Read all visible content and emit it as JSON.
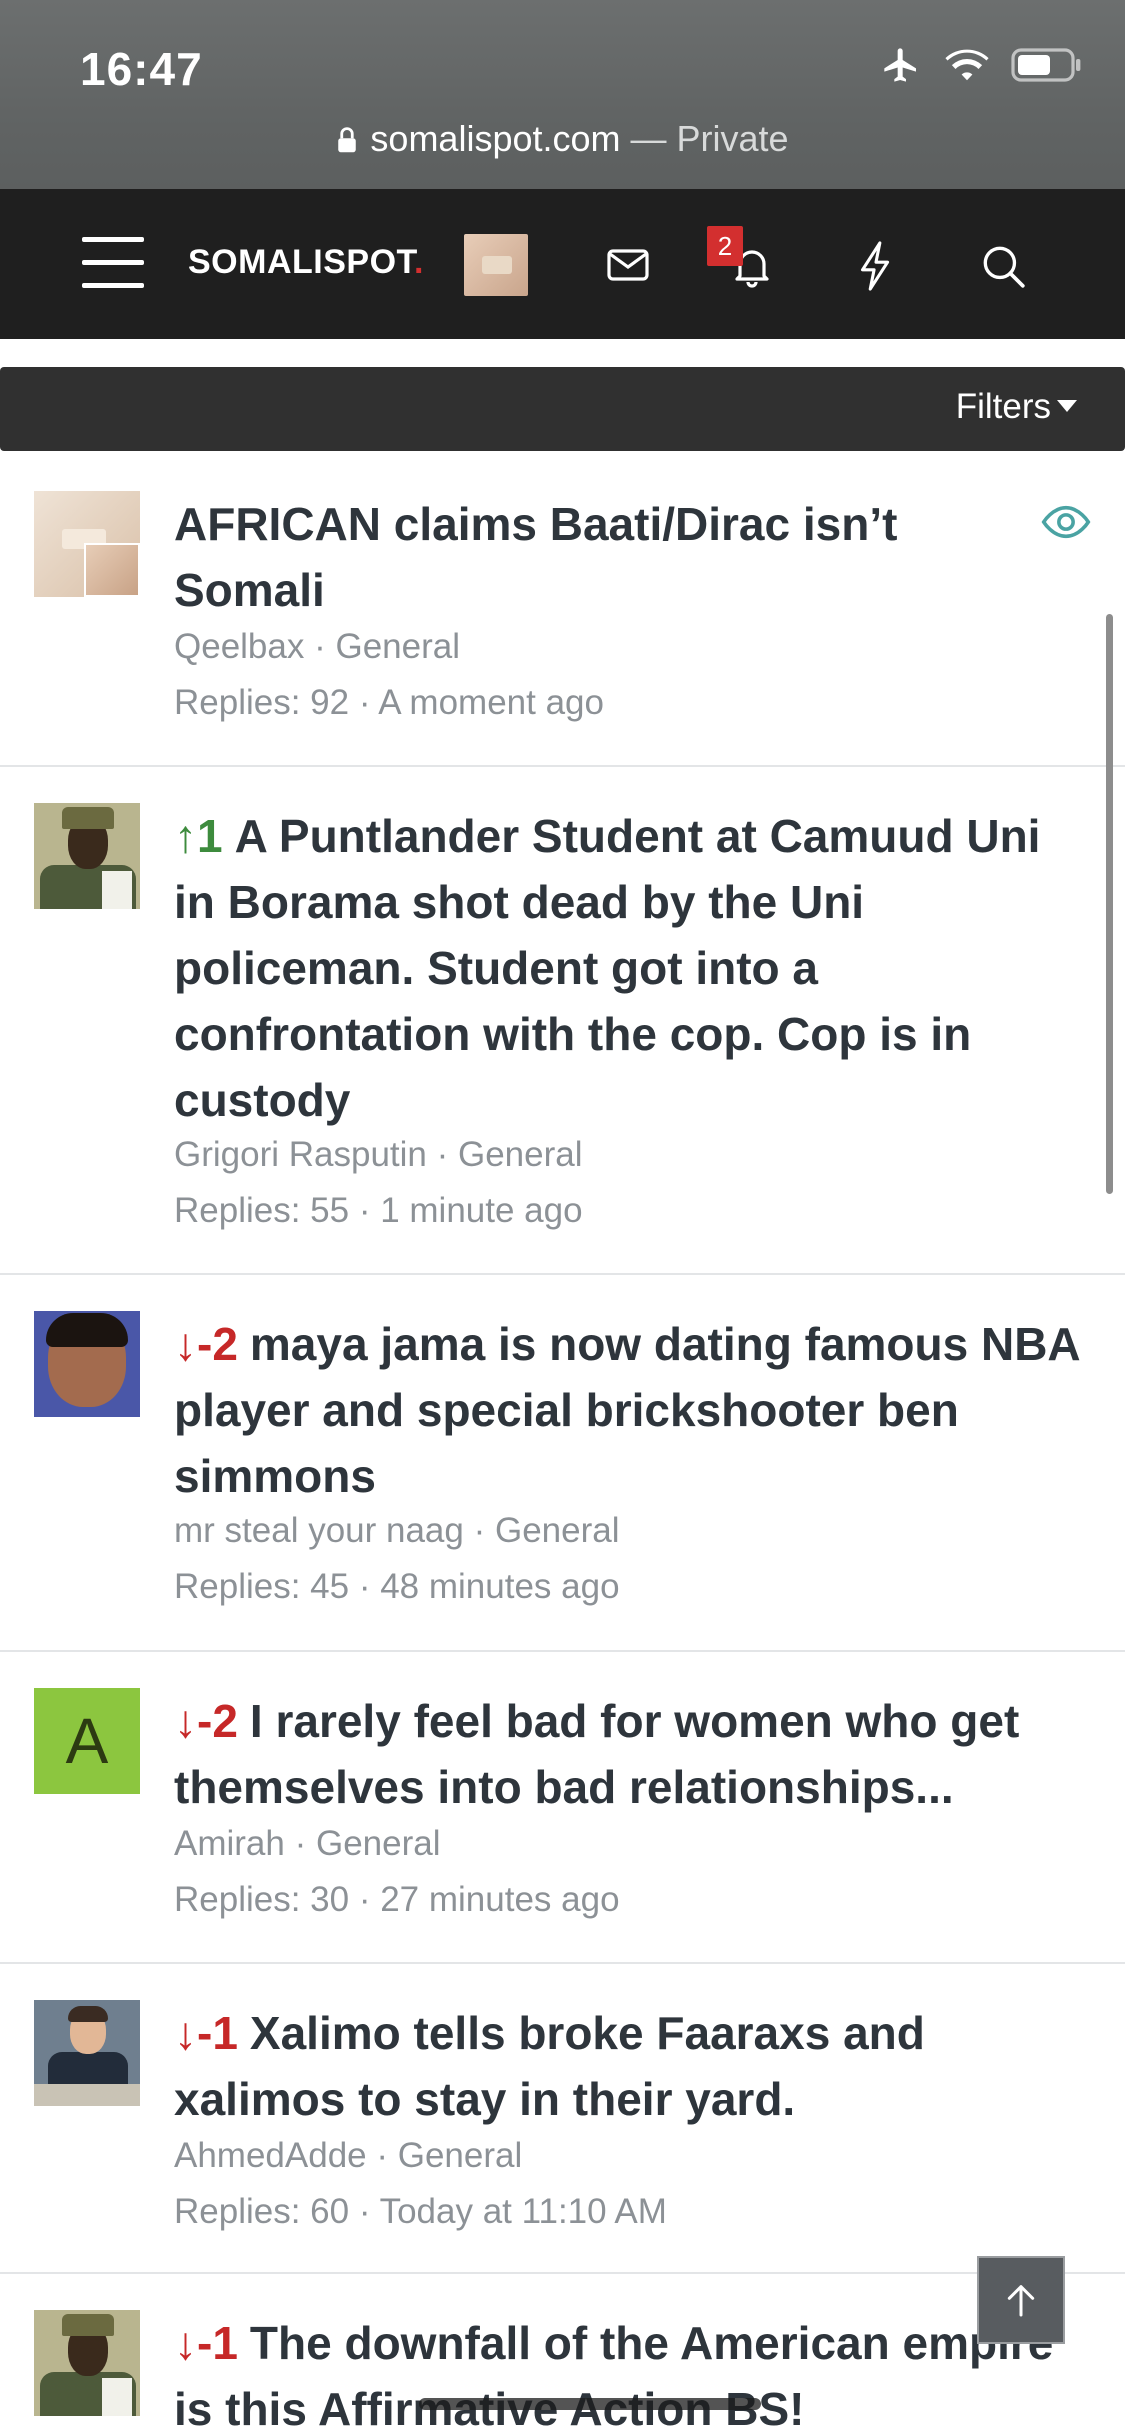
{
  "status_bar": {
    "time": "16:47"
  },
  "browser": {
    "domain": "somalispot.com",
    "suffix": " — Private"
  },
  "header": {
    "logo_text": "SOMALISPOT",
    "logo_dot": ".",
    "alerts_count": "2",
    "icons": [
      "menu-icon",
      "avatar",
      "mail-icon",
      "bell-icon",
      "lightning-icon",
      "search-icon"
    ]
  },
  "filter_bar": {
    "label": "Filters"
  },
  "threads": [
    {
      "vote": "",
      "title": "AFRICAN claims Baati/Dirac isn’t Somali",
      "meta": "Qeelbax · General",
      "stats": "Replies: 92 · A moment ago"
    },
    {
      "vote": "↑1",
      "title": "A Puntlander Student at Camuud Uni in Borama shot dead by the Uni policeman. Student got into a confrontation with the cop. Cop is in custody",
      "meta": "Grigori Rasputin · General",
      "stats": "Replies: 55 · 1 minute ago"
    },
    {
      "vote": "↓-2",
      "title": "maya jama is now dating famous NBA player and special brickshooter ben simmons",
      "meta": "mr steal your naag · General",
      "stats": "Replies: 45 · 48 minutes ago"
    },
    {
      "vote": "↓-2",
      "title": "I rarely feel bad for women who get themselves into bad relationships...",
      "meta": "Amirah · General",
      "stats": "Replies: 30 · 27 minutes ago",
      "avatar_letter": "A"
    },
    {
      "vote": "↓-1",
      "title": "Xalimo tells broke Faaraxs and xalimos to stay in their yard.",
      "meta": "AhmedAdde · General",
      "stats": "Replies: 60 · Today at 11:10 AM"
    },
    {
      "vote": "↓-1",
      "title": "The downfall of the American empire is this Affirmative Action BS!"
    }
  ],
  "colors": {
    "header_bg": "#1f1f1f",
    "accent_red": "#d32f2f",
    "vote_up": "#3d8b3d",
    "vote_down": "#c62828",
    "meta_gray": "#8c9196",
    "watch_icon": "#4aa3a3",
    "letter_avatar": "#8cc63f"
  }
}
